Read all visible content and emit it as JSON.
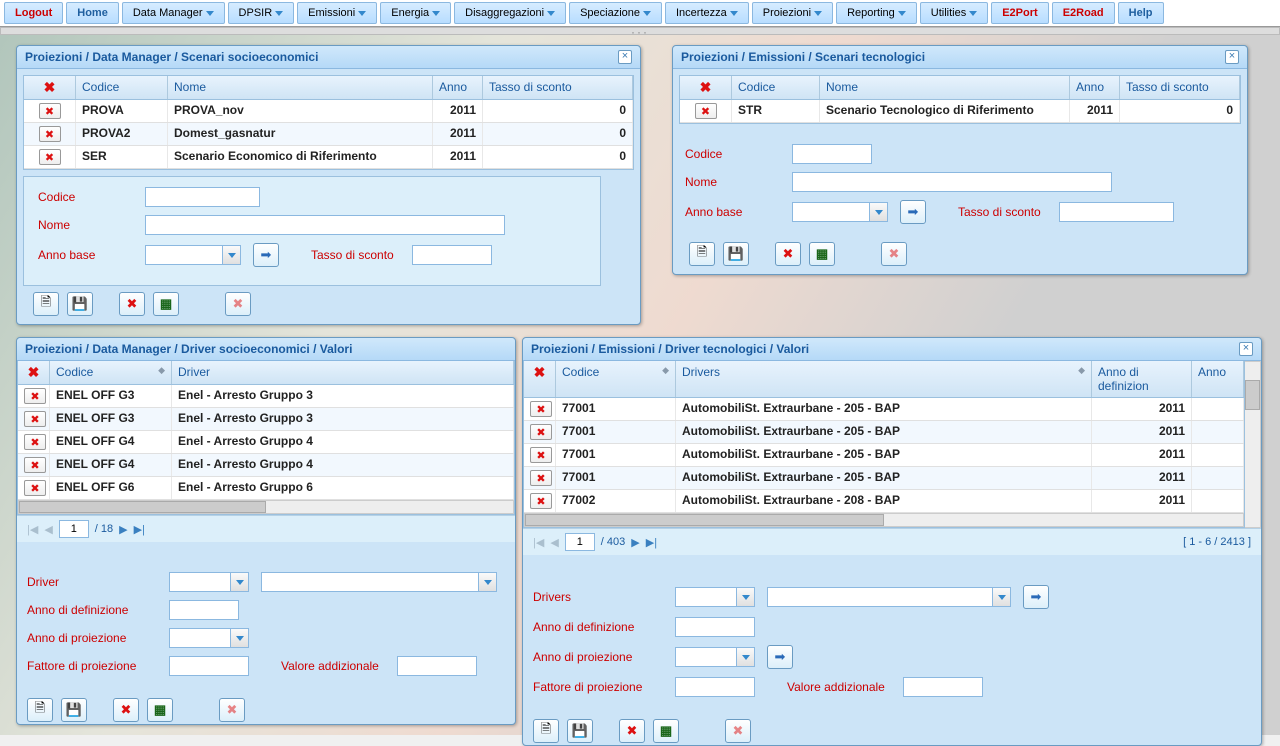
{
  "toolbar": {
    "logout": "Logout",
    "home": "Home",
    "data_manager": "Data Manager",
    "dpsir": "DPSIR",
    "emissioni": "Emissioni",
    "energia": "Energia",
    "disaggregazioni": "Disaggregazioni",
    "speciazione": "Speciazione",
    "incertezza": "Incertezza",
    "proiezioni": "Proiezioni",
    "reporting": "Reporting",
    "utilities": "Utilities",
    "e2port": "E2Port",
    "e2road": "E2Road",
    "help": "Help"
  },
  "common": {
    "col_x": "",
    "col_codice": "Codice",
    "col_nome": "Nome",
    "col_anno": "Anno",
    "col_tasso": "Tasso di sconto",
    "col_driver": "Driver",
    "col_drivers": "Drivers",
    "col_annodef": "Anno di definizion",
    "col_anno2": "Anno",
    "form_codice": "Codice",
    "form_nome": "Nome",
    "form_annobase": "Anno base",
    "form_tasso": "Tasso di sconto",
    "form_driver": "Driver",
    "form_drivers": "Drivers",
    "form_annodef": "Anno di definizione",
    "form_annopro": "Anno di proiezione",
    "form_fattore": "Fattore di proiezione",
    "form_valadd": "Valore addizionale",
    "icon_new": "🗎",
    "icon_save": "💾",
    "icon_del": "✖",
    "icon_excel": "▦",
    "icon_reset": "✖",
    "icon_go": "➡"
  },
  "p1": {
    "title": "Proiezioni / Data Manager / Scenari socioeconomici",
    "rows": [
      {
        "codice": "PROVA",
        "nome": "PROVA_nov",
        "anno": "2011",
        "tasso": "0"
      },
      {
        "codice": "PROVA2",
        "nome": "Domest_gasnatur",
        "anno": "2011",
        "tasso": "0"
      },
      {
        "codice": "SER",
        "nome": "Scenario Economico di Riferimento",
        "anno": "2011",
        "tasso": "0"
      }
    ]
  },
  "p2": {
    "title": "Proiezioni / Emissioni / Scenari tecnologici",
    "rows": [
      {
        "codice": "STR",
        "nome": "Scenario Tecnologico di Riferimento",
        "anno": "2011",
        "tasso": "0"
      }
    ]
  },
  "p3": {
    "title": "Proiezioni / Data Manager / Driver socioeconomici / Valori",
    "rows": [
      {
        "codice": "ENEL OFF G3",
        "driver": "Enel - Arresto Gruppo 3"
      },
      {
        "codice": "ENEL OFF G3",
        "driver": "Enel - Arresto Gruppo 3"
      },
      {
        "codice": "ENEL OFF G4",
        "driver": "Enel - Arresto Gruppo 4"
      },
      {
        "codice": "ENEL OFF G4",
        "driver": "Enel - Arresto Gruppo 4"
      },
      {
        "codice": "ENEL OFF G6",
        "driver": "Enel - Arresto Gruppo 6"
      }
    ],
    "page": "1",
    "pages": "/ 18"
  },
  "p4": {
    "title": "Proiezioni / Emissioni / Driver tecnologici / Valori",
    "rows": [
      {
        "codice": "77001",
        "driver": "AutomobiliSt. Extraurbane - 205 - BAP",
        "anno": "2011"
      },
      {
        "codice": "77001",
        "driver": "AutomobiliSt. Extraurbane - 205 - BAP",
        "anno": "2011"
      },
      {
        "codice": "77001",
        "driver": "AutomobiliSt. Extraurbane - 205 - BAP",
        "anno": "2011"
      },
      {
        "codice": "77001",
        "driver": "AutomobiliSt. Extraurbane - 205 - BAP",
        "anno": "2011"
      },
      {
        "codice": "77002",
        "driver": "AutomobiliSt. Extraurbane - 208 - BAP",
        "anno": "2011"
      }
    ],
    "page": "1",
    "pages": "/ 403",
    "count": "[ 1 - 6 / 2413 ]"
  }
}
